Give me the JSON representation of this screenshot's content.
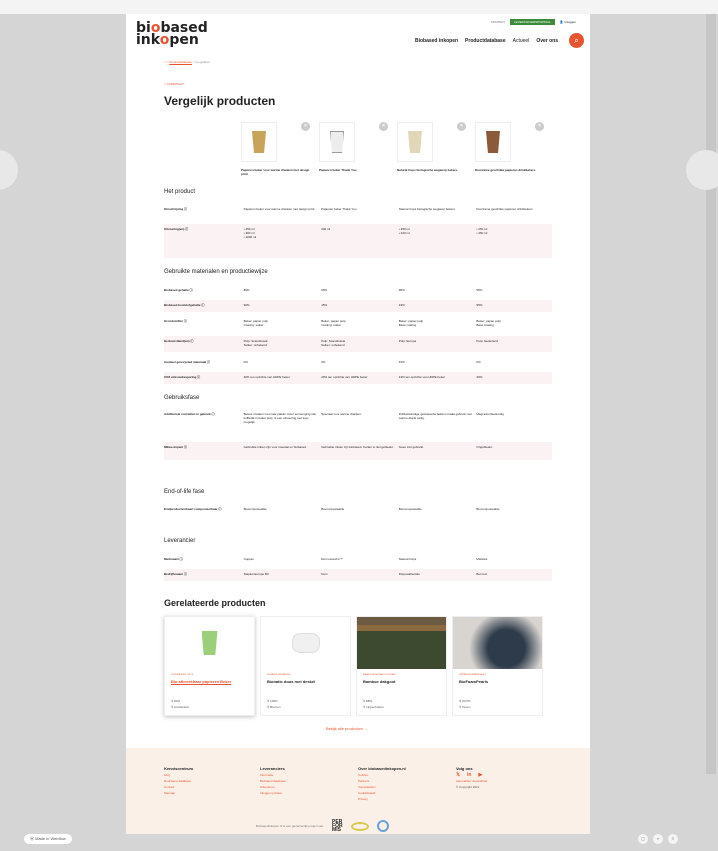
{
  "header": {
    "logo_line1": "bi",
    "logo_o1": "o",
    "logo_rest1": "based",
    "logo_line2": "ink",
    "logo_o2": "o",
    "logo_rest2": "pen",
    "contact": "CONTACT",
    "portal": "LEVERANCIERSPORTAAL",
    "login": "Inloggen",
    "nav": [
      "Biobased inkopen",
      "Productdatabase",
      "Actueel",
      "Over ons"
    ]
  },
  "breadcrumb": {
    "home": "⌂",
    "sep": ">",
    "link": "Productdatabase",
    "current": "Vergelijken"
  },
  "back_label": "< OVERZICHT",
  "page_title": "Vergelijk producten",
  "products": [
    {
      "name": "Papieren beker voor warme dranken met design print",
      "cup_color": "#c8a35a"
    },
    {
      "name": "Papieren beker Thank You",
      "cup_color": "#ededed"
    },
    {
      "name": "Natural Cups biologische wegwerp bekers",
      "cup_color": "#e2d6b8"
    },
    {
      "name": "Duurzame geschikte papieren drinkbekers",
      "cup_color": "#8a5a3a"
    }
  ],
  "sections": {
    "product": "Het product",
    "materials": "Gebruikte materialen en productiewijze",
    "use": "Gebruiksfase",
    "eol": "End-of-life fase",
    "supplier": "Leverancier"
  },
  "rows": {
    "omschrijving": {
      "label": "Omschrijving ⓘ",
      "vals": [
        "Papieren beker voor warme dranken met design print.",
        "Papieren beker Thank You",
        "Natural Cups biologische wegwerp bekers",
        "Duurzame geschikte papieren drinkbekers"
      ]
    },
    "uitvoering": {
      "label": "Uitvoering(en) ⓘ",
      "vals": [
        "• 250 ml\n• 360 ml\n• 1000 ml",
        "240 ml",
        "• 250 ml\n• 340 ml",
        "• 250 ml\n• 360 ml"
      ]
    },
    "biobased": {
      "label": "Biobased gehalte ⓘ",
      "vals": [
        "89%",
        "95%",
        "95%",
        "95%"
      ]
    },
    "koolstof": {
      "label": "Biobased koolstofgehalte ⓘ",
      "vals": [
        "90%",
        "15%",
        "19%",
        "95%"
      ]
    },
    "grondstoffen": {
      "label": "Grondstoffen ⓘ",
      "vals": [
        "Beker: papier pulp\nCoating: suiker",
        "Beker: papier pulp\nCoating: suiker",
        "Beker: papier pulp\nBase coating",
        "Beker: papier pulp\nBase coating"
      ]
    },
    "herkomst": {
      "label": "Herkomstland(en) ⓘ",
      "vals": [
        "Pulp: Scandinavië\nSuiker: onbekend",
        "Pulp: Scandinavië\nSuiker: onbekend",
        "Pulp: Europa",
        "Pulp: Nederland"
      ]
    },
    "recycled": {
      "label": "Aandeel gerecycled materiaal ⓘ",
      "vals": [
        "0%",
        "0%",
        "10%",
        "0%"
      ]
    },
    "co2": {
      "label": "CO2 emissiebesparing ⓘ",
      "vals": [
        "40% ten opzichte van HDPE beker",
        "20% ten opzichte van HDPE beker",
        "13% ten opzichte van HDPE beker",
        "30%"
      ]
    },
    "voordelen": {
      "label": "Additionele voordelen in gebruik ⓘ",
      "vals": [
        "Betere smaken met naar plastic. Door vermenging van koffiedik in beker pulp, is een uitvoering met logo mogelijk.",
        "Speciaal voor warme dranken.",
        "Dubbelwandige geïsoleerde bekers maakt gebruik voor warme drank veilig.",
        "Magnetronbestendig"
      ]
    },
    "milieu": {
      "label": "Milieu-impact ⓘ",
      "vals": [
        "Gebruikte inkten zijn voor meestal en biobased.",
        "Gebruikte inkten zijn biobased. Kartan is niet gebleekt.",
        "Geen inkt gebruikt.",
        "Ongebleekt."
      ]
    },
    "eind": {
      "label": "Eindproductverbaarl composteerbaar ⓘ",
      "vals": [
        "Biocomposteable",
        "Biocomposteable",
        "Biocomposteable",
        "Biocomposteable"
      ]
    },
    "merknaam": {
      "label": "Merknaam ⓘ",
      "vals": [
        "Cuppss",
        "Duni ecoecho™",
        "Natural Cups",
        "Markisis"
      ]
    },
    "bedrijf": {
      "label": "Bedrijfsnaam ⓘ",
      "vals": [
        "Staples Europe BV",
        "Duni",
        "Disposablecake",
        "Bol.com"
      ]
    }
  },
  "related": {
    "title": "Gerelateerde producten",
    "cards": [
      {
        "cat": "Koffiebekers om te",
        "title": "Bio afbreekbaar papieren Beker",
        "m1": "⚲ 80%",
        "m2": "⚲ Amsterdam"
      },
      {
        "cat": "Biobased verpakking",
        "title": "Bionatic doos met deskel",
        "m1": "⚲ 100%",
        "m2": "⚲ Bremen"
      },
      {
        "cat": "Bamboe regelpaal & rolrand",
        "title": "Bamboe dakgoot",
        "m1": "⚲ 88%",
        "m2": "⚲ Lippenhuizen"
      },
      {
        "cat": "Verpakkingsmaterialen",
        "title": "BioFoamPearls",
        "m1": "⚲ 30,5%",
        "m2": "⚲ Zeven"
      }
    ],
    "all_link": "Bekijk alle producten →"
  },
  "footer": {
    "col1": {
      "title": "Kenniscentrum",
      "items": [
        "FAQ",
        "Duurzame database",
        "Contact",
        "Sitemap"
      ]
    },
    "col2": {
      "title": "Leveranciers",
      "items": [
        "Informatie",
        "Biobased database",
        "Adverteren",
        "Inloggen portaal"
      ]
    },
    "col3": {
      "title": "Over biobasedinkopen.nl",
      "items": [
        "Colofon",
        "Partners",
        "Voorwaarden",
        "Cookiebeleid",
        "Privacy"
      ]
    },
    "col4": {
      "title": "Volg ons",
      "social": [
        "𝕏",
        "in",
        "▶"
      ],
      "newsletter": "Aanmelden nieuwsbrief",
      "copyright": "© Copyright 2021"
    },
    "bottom_text": "Biobasedinkopen.nl is een gezamenlijk project van:",
    "badge": "PER\nFOR\nMIS"
  },
  "madein": "Made in Webflow"
}
